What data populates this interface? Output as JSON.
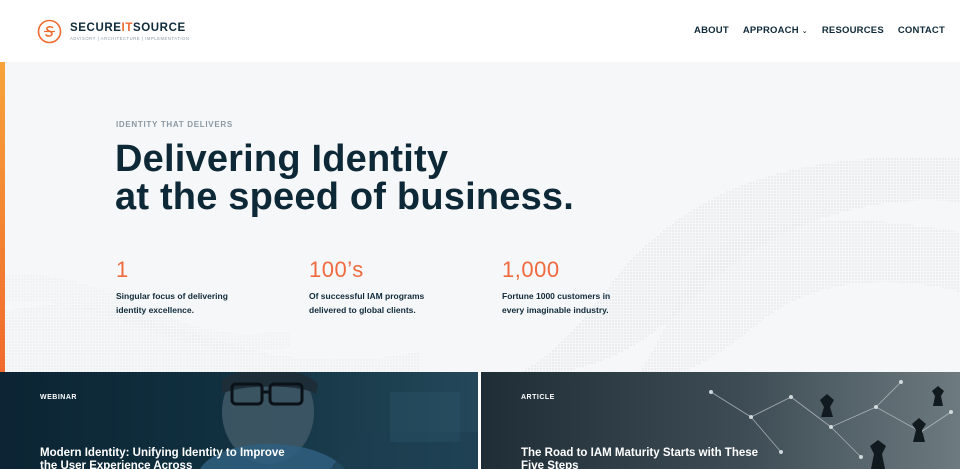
{
  "brand": {
    "name_part1": "SECURE",
    "name_part2": "IT",
    "name_part3": "SOURCE",
    "tagline": "ADVISORY | ARCHITECTURE | IMPLEMENTATION",
    "accent_color": "#ef6a2f",
    "navy_color": "#0f2a3a"
  },
  "nav": {
    "items": [
      {
        "label": "ABOUT"
      },
      {
        "label": "APPROACH",
        "has_dropdown": true
      },
      {
        "label": "RESOURCES"
      },
      {
        "label": "CONTACT"
      }
    ]
  },
  "hero": {
    "eyebrow": "IDENTITY THAT DELIVERS",
    "headline_line1": "Delivering Identity",
    "headline_line2": "at the speed of business.",
    "stats": [
      {
        "number": "1",
        "line1": "Singular focus of delivering",
        "line2": "identity excellence."
      },
      {
        "number": "100’s",
        "line1": "Of successful IAM programs",
        "line2": "delivered to global clients."
      },
      {
        "number": "1,000",
        "line1": "Fortune 1000 customers in",
        "line2": "every imaginable industry."
      }
    ]
  },
  "cards": [
    {
      "tag": "WEBINAR",
      "title": "Modern Identity:  Unifying Identity to Improve the User Experience Across"
    },
    {
      "tag": "ARTICLE",
      "title": "The Road to IAM Maturity Starts with These Five Steps"
    }
  ]
}
